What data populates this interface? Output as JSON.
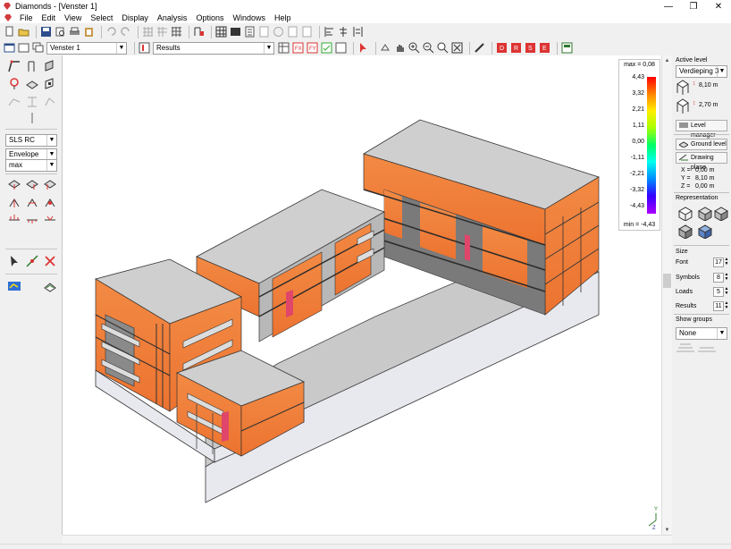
{
  "app": {
    "title": "Diamonds - [Venster 1]"
  },
  "menu": [
    "File",
    "Edit",
    "View",
    "Select",
    "Display",
    "Analysis",
    "Options",
    "Windows",
    "Help"
  ],
  "toolbar2": {
    "view_combo": "Venster 1",
    "mode_combo": "Results"
  },
  "left": {
    "combo1": "SLS RC",
    "combo2": "Envelope",
    "combo3": "max"
  },
  "legend": {
    "max_label": "max = 0,08",
    "min_label": "min = -4,43",
    "ticks": [
      "4,43",
      "3,32",
      "2,21",
      "1,11",
      "0,00",
      "-1,11",
      "-2,21",
      "-3,32",
      "-4,43"
    ]
  },
  "right": {
    "active_level_title": "Active level",
    "active_level": "Verdieping 3",
    "level_height_1": "8,10 m",
    "level_height_2": "2,70 m",
    "level_manager": "Level manager",
    "ground_level": "Ground level",
    "drawing_plane": "Drawing plane",
    "coords": [
      {
        "k": "X =",
        "v": "0,00 m"
      },
      {
        "k": "Y =",
        "v": "8,10 m"
      },
      {
        "k": "Z =",
        "v": "0,00 m"
      }
    ],
    "representation_title": "Representation",
    "size_title": "Size",
    "sizes": [
      {
        "label": "Font",
        "value": "17"
      },
      {
        "label": "Symbols",
        "value": "8"
      },
      {
        "label": "Loads",
        "value": "5"
      },
      {
        "label": "Results",
        "value": "11"
      }
    ],
    "show_groups_title": "Show groups",
    "show_groups_value": "None"
  },
  "colors": {
    "orange": "#f0803a",
    "slab": "#c3c3c3",
    "slab_top": "#cecece",
    "edge": "#3a3a3a",
    "base": "#e6e6ee"
  }
}
